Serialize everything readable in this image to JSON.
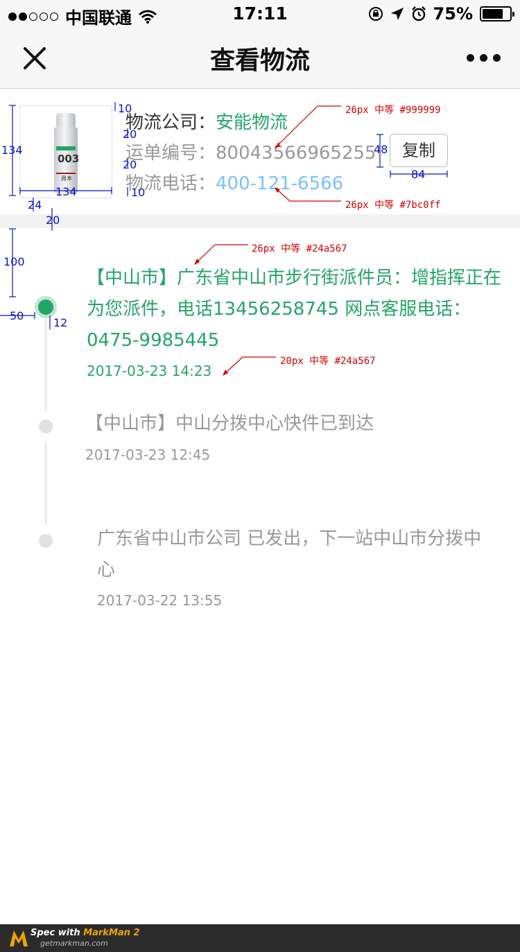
{
  "status_bar": {
    "carrier": "中国联通",
    "time": "17:11",
    "battery_text": "75%",
    "battery_level": 0.75,
    "signal_dots_filled": 2,
    "signal_dots_total": 5,
    "icons": [
      "wifi-icon",
      "orientation-lock-icon",
      "location-icon",
      "alarm-icon",
      "battery-icon"
    ]
  },
  "nav": {
    "title": "查看物流",
    "left_icon": "close-icon",
    "right_icon": "more-icon"
  },
  "logistics": {
    "company_label": "物流公司：",
    "company_value": "安能物流",
    "waybill_label": "运单编号：",
    "waybill_value": "80043566965255",
    "phone_label": "物流电话：",
    "phone_value": "400-121-6566",
    "copy_button": "复制",
    "product_image": {
      "brand": "003",
      "caption": "周本"
    }
  },
  "timeline": [
    {
      "text": "【中山市】广东省中山市步行街派件员：增指挥正在为您派件，电话13456258745 网点客服电话：0475-9985445",
      "lines": [
        "【中山市】广东省中山市步行街派件员：增指挥正在",
        "为您派件，电话13456258745 网点客服电话：",
        "0475-9985445"
      ],
      "time": "2017-03-23  14:23",
      "active": true
    },
    {
      "text": "【中山市】中山分拨中心快件已到达",
      "lines": [
        "【中山市】中山分拨中心快件已到达"
      ],
      "time": "2017-03-23  12:45",
      "active": false
    },
    {
      "text": "广东省中山市公司  已发出，下一站中山市分拨中心",
      "lines": [
        "广东省中山市公司  已发出，下一站中山市分拨中",
        "心"
      ],
      "time": "2017-03-22 13:55",
      "active": false
    }
  ],
  "annotations": {
    "dims": {
      "img_size_v": "134",
      "img_size_h": "134",
      "top_gap": "10",
      "gap_a": "20",
      "gap_b": "20",
      "bottom_gap": "10",
      "left_gap": "24",
      "band": "20",
      "btn_h": "48",
      "btn_w": "84",
      "top_margin": "100",
      "left_margin": "50",
      "dot": "12"
    },
    "notes": {
      "waybill": "26px 中等 #999999",
      "phone": "26px 中等 #7bc0ff",
      "entry": "26px 中等 #24a567",
      "time": "20px 中等 #24a567"
    }
  },
  "colors": {
    "green": "#24a567",
    "gray": "#999999",
    "blue": "#7bc0ff",
    "annotation_blue": "#0a14c8",
    "annotation_red": "#d40000"
  },
  "footer": {
    "brand_prefix": "Spec with ",
    "brand_name": "MarkMan 2",
    "url": "getmarkman.com"
  }
}
